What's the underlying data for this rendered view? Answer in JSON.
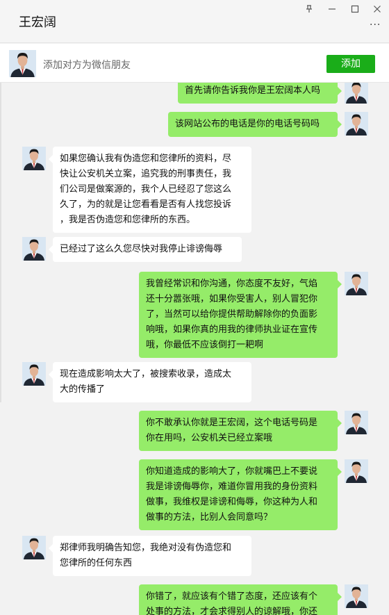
{
  "window": {
    "title": "王宏阔",
    "controls": [
      "pin-icon",
      "minimize-icon",
      "maximize-icon",
      "close-icon"
    ],
    "more_label": "···"
  },
  "add_friend": {
    "text": "添加对方为微信朋友",
    "button_label": "添加",
    "button_color": "#1aad19"
  },
  "colors": {
    "sent_bubble": "#95ec69",
    "received_bubble": "#ffffff",
    "background": "#f2f2f2"
  },
  "messages": [
    {
      "side": "right",
      "text": "首先请你告诉我你是王宏阔本人吗"
    },
    {
      "side": "right",
      "text": "该网站公布的电话是你的电话号码吗"
    },
    {
      "side": "left",
      "lines": [
        "如果您确认我有伪造您和您律所的资料，尽",
        "快让公安机关立案，追究我的刑事责任，我",
        "们公司是做案源的，我个人已经忍了您这么",
        "久了，为的就是让您看看是否有人找您投诉",
        "，我是否伪造您和您律所的东西。"
      ]
    },
    {
      "side": "left",
      "text": "已经过了这么久您尽快对我停止诽谤侮辱"
    },
    {
      "side": "right",
      "lines": [
        "我曾经常识和你沟通，你态度不友好，气焰",
        "还十分嚣张哦，如果你受害人，别人冒犯你",
        "了，当然可以给你提供帮助解除你的负面影",
        "响哦，如果你真的用我的律师执业证在宣传",
        "哦，你最低不应该倒打一耙啊"
      ]
    },
    {
      "side": "left",
      "lines": [
        "现在造成影响太大了，被搜索收录，造成太",
        "大的传播了"
      ]
    },
    {
      "side": "right",
      "lines": [
        "你不敢承认你就是王宏阔，这个电话号码是",
        "你在用吗，公安机关已经立案哦"
      ]
    },
    {
      "side": "right",
      "lines": [
        "你知道造成的影响大了，你就嘴巴上不要说",
        "我是诽谤侮辱你，难道你冒用我的身份资料",
        "做事，我维权是诽谤和侮辱，你这种为人和",
        "做事的方法，比别人会同意吗？"
      ]
    },
    {
      "side": "left",
      "lines": [
        "郑律师我明确告知您，我绝对没有伪造您和",
        "您律所的任何东西"
      ]
    },
    {
      "side": "right",
      "lines": [
        "你错了，就应该有个错了态度，还应该有个",
        "处事的方法，才会求得别人的谅解哦，你还"
      ]
    }
  ]
}
